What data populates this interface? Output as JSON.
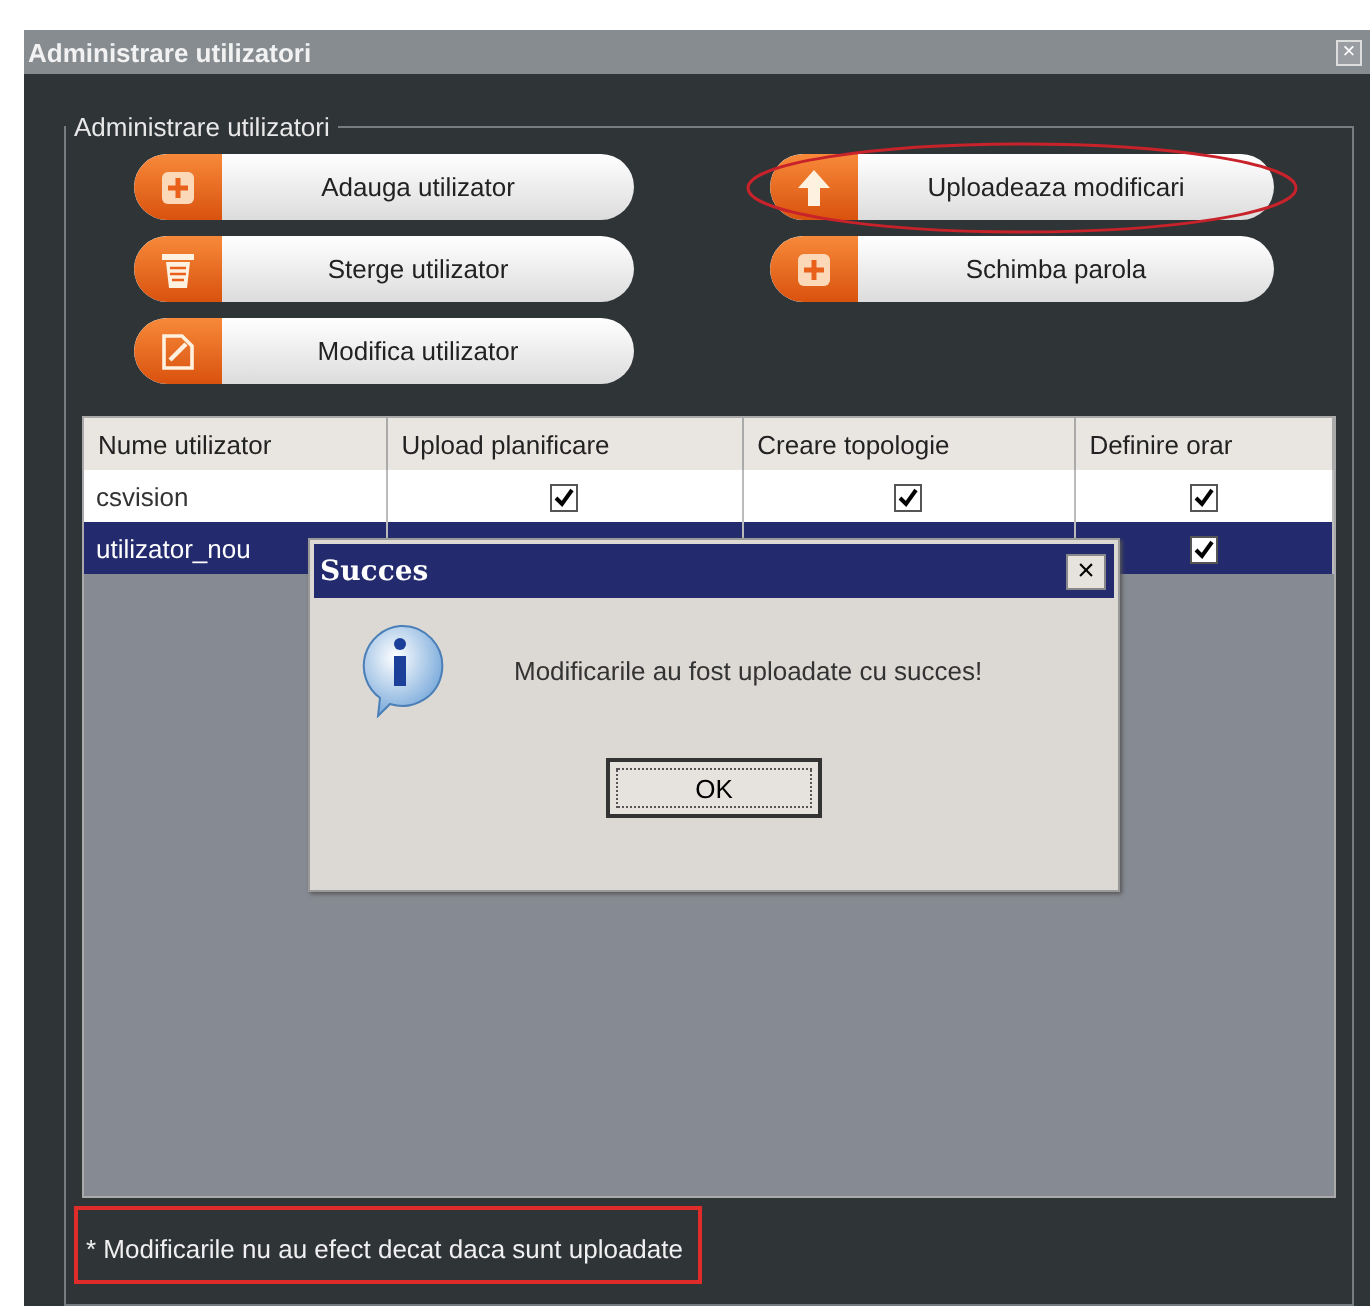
{
  "window": {
    "title": "Administrare utilizatori",
    "close": "×"
  },
  "group": {
    "legend": "Administrare utilizatori"
  },
  "buttons": [
    {
      "label": "Adauga utilizator",
      "kind": "add",
      "highlighted": false
    },
    {
      "label": "Uploadeaza modificari",
      "kind": "upload",
      "highlighted": true
    },
    {
      "label": "Sterge utilizator",
      "kind": "delete",
      "highlighted": false
    },
    {
      "label": "Schimba parola",
      "kind": "add",
      "highlighted": false
    },
    {
      "label": "Modifica utilizator",
      "kind": "edit",
      "highlighted": false
    }
  ],
  "table": {
    "columns": [
      "Nume utilizator",
      "Upload planificare",
      "Creare topologie",
      "Definire orar"
    ],
    "rows": [
      {
        "name": "csvision",
        "selected": false,
        "checks": [
          true,
          true,
          true
        ]
      },
      {
        "name": "utilizator_nou",
        "selected": true,
        "checks": [
          true
        ]
      }
    ]
  },
  "dialog": {
    "title": "Succes",
    "close": "×",
    "message": "Modificarile au fost uploadate cu succes!",
    "button": "OK"
  },
  "footnote": {
    "text": "* Modificarile nu au efect decat daca sunt uploadate",
    "highlighted": true
  }
}
